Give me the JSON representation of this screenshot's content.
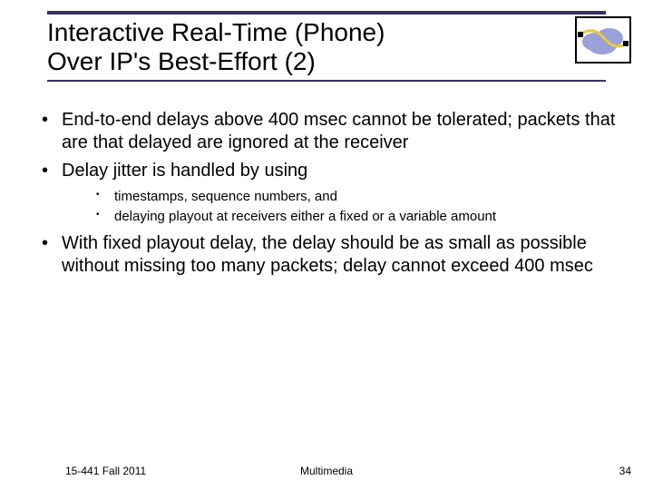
{
  "title": {
    "line1": "Interactive Real-Time (Phone)",
    "line2": "Over IP's Best-Effort (2)"
  },
  "bullets": {
    "b1": "End-to-end delays above 400 msec cannot be tolerated; packets that are that delayed are ignored at the receiver",
    "b2": "Delay jitter is handled by using",
    "b2_sub1": "timestamps, sequence numbers, and",
    "b2_sub2": "delaying playout at receivers either a fixed or a variable amount",
    "b3": "With fixed playout delay, the delay should be as small as possible without missing too many packets; delay cannot exceed 400 msec"
  },
  "footer": {
    "left": "15-441 Fall 2011",
    "center": "Multimedia",
    "right": "34"
  },
  "icon": {
    "name": "network-cloud-icon"
  },
  "colors": {
    "accent": "#333366",
    "cloud": "#9aa0d8",
    "wire": "#e6c84a"
  }
}
